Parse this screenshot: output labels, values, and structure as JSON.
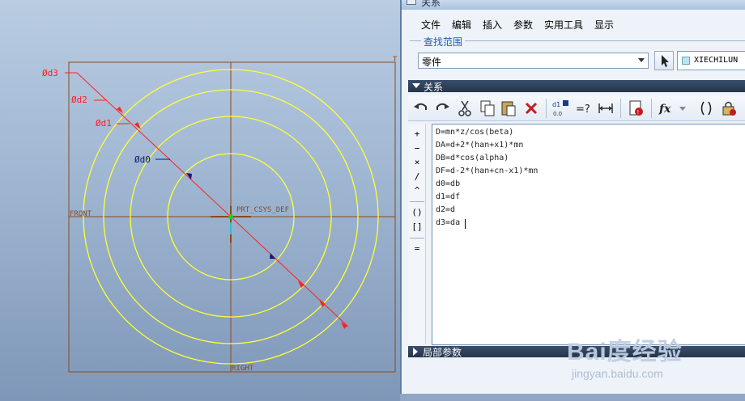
{
  "viewport": {
    "dimensions": [
      {
        "id": "d3",
        "label": "Ød3"
      },
      {
        "id": "d2",
        "label": "Ød2"
      },
      {
        "id": "d1",
        "label": "Ød1"
      },
      {
        "id": "d0",
        "label": "Ød0"
      }
    ],
    "datum_front": "FRONT",
    "datum_right": "RIGHT",
    "datum_top": "T",
    "csys_label": "PRT_CSYS_DEF",
    "colors": {
      "circle": "#ffff33",
      "datum": "#8a4a1c",
      "dimension": "#ff2020",
      "selected_dimension": "#0a1a6a",
      "csys": "#22cc22"
    }
  },
  "dialog": {
    "title": "关系",
    "menu": [
      "文件",
      "编辑",
      "插入",
      "参数",
      "实用工具",
      "显示"
    ],
    "search_group_label": "查找范围",
    "scope_value": "零件",
    "model_name": "XIECHILUN",
    "relations_header": "关系",
    "toolbar_icons": [
      "undo-icon",
      "redo-icon",
      "cut-icon",
      "copy-icon",
      "paste-icon",
      "delete-icon",
      "show-dims-icon",
      "evaluate-icon",
      "sort-icon",
      "verify-icon",
      "function-icon",
      "parentheses-icon",
      "lock-icon"
    ],
    "operators": [
      "+",
      "−",
      "×",
      "/",
      "^",
      "()",
      "[]",
      "="
    ],
    "equations": [
      "D=mn*z/cos(beta)",
      "DA=d+2*(han+x1)*mn",
      "DB=d*cos(alpha)",
      "DF=d-2*(han+cn-x1)*mn",
      "d0=db",
      "d1=df",
      "d2=d",
      "d3=da"
    ],
    "local_params_header": "局部参数"
  },
  "watermark": {
    "brand": "Bai度经验",
    "url": "jingyan.baidu.com"
  }
}
